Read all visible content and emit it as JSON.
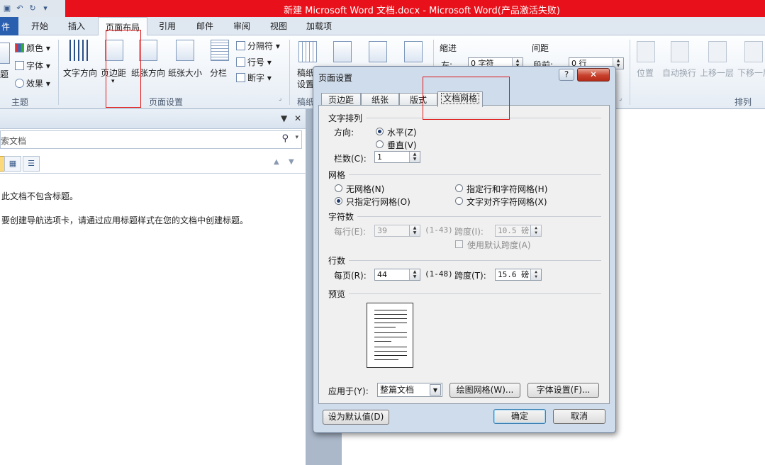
{
  "window": {
    "title": "新建 Microsoft Word 文档.docx - Microsoft Word(产品激活失败)"
  },
  "ribbon_tabs": [
    "件",
    "开始",
    "插入",
    "页面布局",
    "引用",
    "邮件",
    "审阅",
    "视图",
    "加载项"
  ],
  "ribbon": {
    "theme": {
      "colors": "颜色",
      "fonts": "字体",
      "effects": "效果",
      "group": "主题",
      "themes_fragment": "题"
    },
    "page_setup": {
      "text_direction": "文字方向",
      "margins": "页边距",
      "orientation": "纸张方向",
      "size": "纸张大小",
      "columns": "分栏",
      "breaks": "分隔符",
      "line_numbers": "行号",
      "hyphenation": "断字",
      "group": "页面设置"
    },
    "manuscript": {
      "label_top": "稿纸",
      "label_bottom": "设置",
      "group": "稿纸"
    },
    "paragraph": {
      "indent": "缩进",
      "indent_left_label": "左:",
      "indent_left_value": "0 字符",
      "spacing": "间距",
      "spacing_before_label": "段前:",
      "spacing_before_value": "0 行"
    },
    "arrange": {
      "position": "位置",
      "wrap_text": "自动换行",
      "bring_forward": "上移一层",
      "send_backward": "下移一层",
      "group": "排列"
    }
  },
  "nav_pane": {
    "search_placeholder": "索文档",
    "msg_no_headings": "此文档不包含标题。",
    "msg_create_tab": "要创建导航选项卡，请通过应用标题样式在您的文档中创建标题。"
  },
  "dialog": {
    "title": "页面设置",
    "help": "?",
    "close": "✕",
    "tabs": [
      "页边距",
      "纸张",
      "版式",
      "文档网格"
    ],
    "text_layout": {
      "section": "文字排列",
      "direction_label": "方向:",
      "horizontal": "水平(Z)",
      "vertical": "垂直(V)",
      "columns_label": "栏数(C):",
      "columns_value": "1"
    },
    "grid": {
      "section": "网格",
      "no_grid": "无网格(N)",
      "lines_only": "只指定行网格(O)",
      "lines_and_chars": "指定行和字符网格(H)",
      "snap_to_chars": "文字对齐字符网格(X)"
    },
    "characters": {
      "section": "字符数",
      "per_line_label": "每行(E):",
      "per_line_value": "39",
      "per_line_range": "(1-43)",
      "pitch_label": "跨度(I):",
      "pitch_value": "10.5 磅",
      "default_pitch": "使用默认跨度(A)"
    },
    "lines": {
      "section": "行数",
      "per_page_label": "每页(R):",
      "per_page_value": "44",
      "per_page_range": "(1-48)",
      "pitch_label": "跨度(T):",
      "pitch_value": "15.6 磅"
    },
    "preview": {
      "section": "预览"
    },
    "apply_to_label": "应用于(Y):",
    "apply_to_value": "整篇文档",
    "drawing_grid": "绘图网格(W)...",
    "font_settings": "字体设置(F)...",
    "set_default": "设为默认值(D)",
    "ok": "确定",
    "cancel": "取消"
  }
}
